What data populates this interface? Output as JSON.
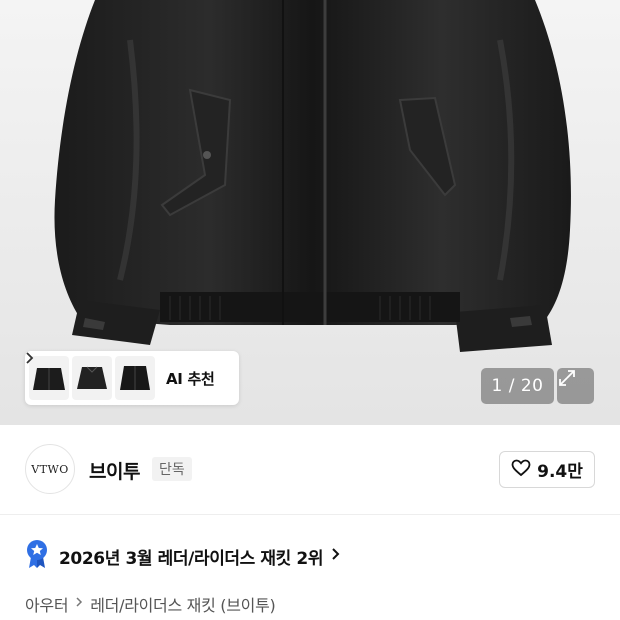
{
  "hero": {
    "counter_current": "1",
    "counter_total": "20",
    "counter_text": "1 / 20",
    "expand_icon": "expand-icon"
  },
  "ai_recommend": {
    "label": "AI 추천",
    "thumb_count": 3,
    "chevron_icon": "chevron-right-icon"
  },
  "brand": {
    "logo_text": "VTWO",
    "name": "브이투",
    "badge": "단독",
    "like_icon": "heart-icon",
    "like_count": "9.4만"
  },
  "ranking": {
    "icon": "ranking-medal-icon",
    "text": "2026년 3월 레더/라이더스 재킷 2위",
    "chevron_icon": "chevron-right-icon",
    "accent_color": "#2f6fe4"
  },
  "breadcrumb": {
    "items": [
      "아우터",
      "레더/라이더스 재킷 (브이투)"
    ],
    "separator_icon": "chevron-right-icon"
  }
}
